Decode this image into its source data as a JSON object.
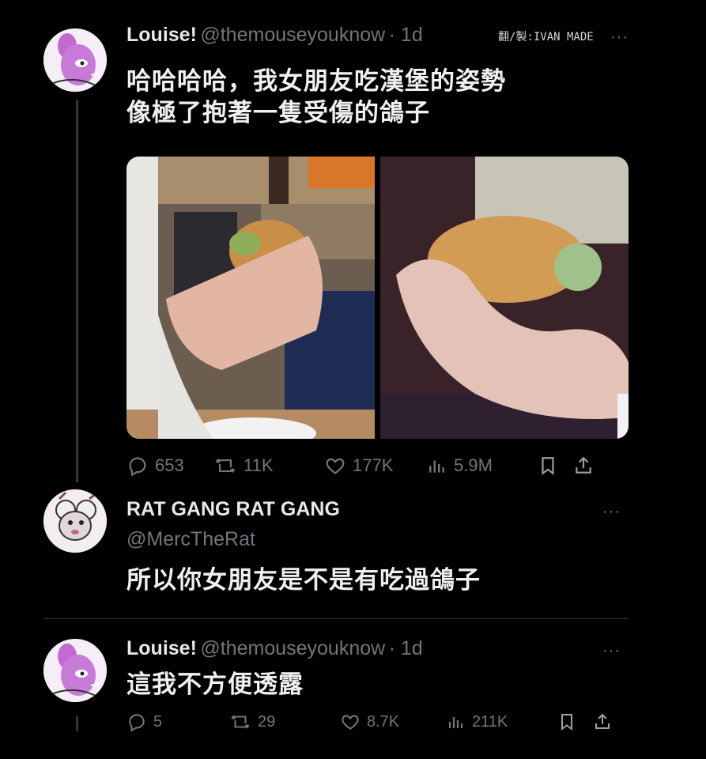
{
  "watermark": "翻/製:IVAN MADE",
  "tweets": [
    {
      "display_name": "Louise!",
      "handle": "@themouseyouknow",
      "time": "· 1d",
      "text_line1": "哈哈哈哈，我女朋友吃漢堡的姿勢",
      "text_line2": "像極了抱著一隻受傷的鴿子",
      "stats": {
        "replies": "653",
        "reposts": "11K",
        "likes": "177K",
        "views": "5.9M"
      }
    },
    {
      "display_name": "RAT GANG RAT GANG",
      "handle": "@MercTheRat",
      "text": "所以你女朋友是不是有吃過鴿子"
    },
    {
      "display_name": "Louise!",
      "handle": "@themouseyouknow",
      "time": "· 1d",
      "text": "這我不方便透露",
      "stats": {
        "replies": "5",
        "reposts": "29",
        "likes": "8.7K",
        "views": "211K"
      }
    }
  ],
  "more_label": "···",
  "icons": [
    "reply-icon",
    "repost-icon",
    "like-icon",
    "views-icon",
    "bookmark-icon",
    "share-icon"
  ]
}
